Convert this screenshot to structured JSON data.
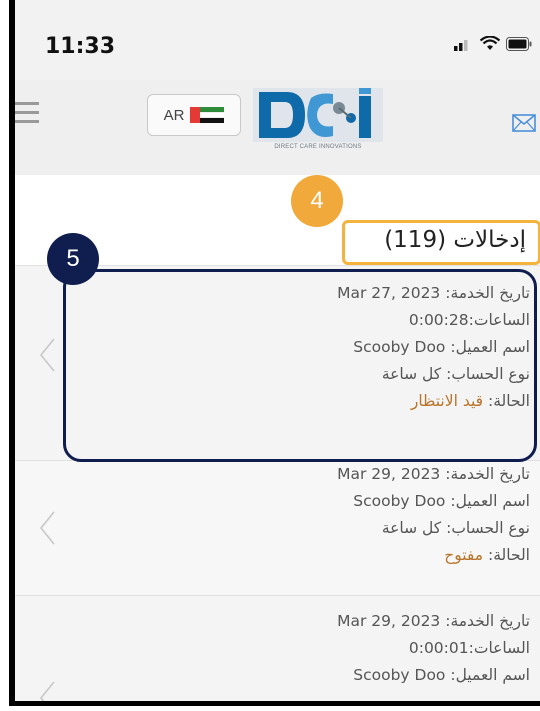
{
  "status_bar": {
    "time": "11:33"
  },
  "header": {
    "lang_label": "AR",
    "logo_text": "DIRECT CARE INNOVATIONS"
  },
  "entries": {
    "title": "إدخالات (119)"
  },
  "callouts": {
    "four": "4",
    "five": "5"
  },
  "labels": {
    "service_date": "تاريخ الخدمة: ",
    "hours": "الساعات:",
    "client_name": "اسم العميل: ",
    "account_type": "نوع الحساب: ",
    "status": "الحالة: "
  },
  "rows": [
    {
      "service_date": "Mar 27, 2023",
      "hours": "0:00:28",
      "client": "Scooby Doo",
      "account_type": "كل ساعة",
      "status": "قيد الانتظار"
    },
    {
      "service_date": "Mar 29, 2023",
      "client": "Scooby Doo",
      "account_type": "كل ساعة",
      "status": "مفتوح"
    },
    {
      "service_date": "Mar 29, 2023",
      "hours": "0:00:01",
      "client": "Scooby Doo"
    }
  ],
  "colors": {
    "callout_4": "#f0a93a",
    "callout_5": "#0f1e4f",
    "status_text": "#b8742a",
    "mail_icon": "#4a90d9"
  }
}
